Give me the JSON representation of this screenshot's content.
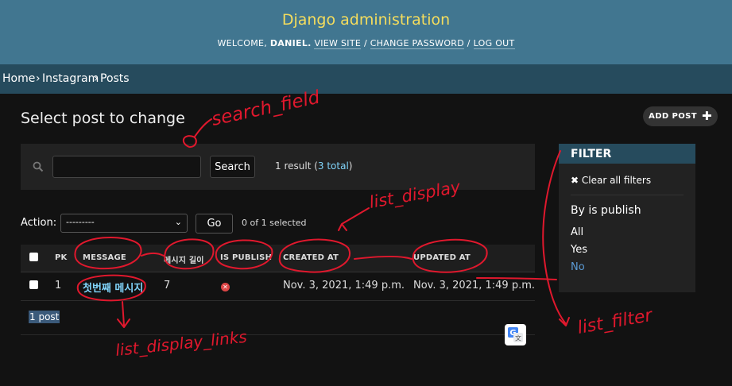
{
  "header": {
    "site_title": "Django administration",
    "welcome_prefix": "WELCOME,",
    "user_name": "DANIEL",
    "view_site": "VIEW SITE",
    "change_password": "CHANGE PASSWORD",
    "log_out": "LOG OUT",
    "separator": "/"
  },
  "breadcrumbs": [
    "Home",
    "Instagram",
    "Posts"
  ],
  "breadcrumb_separator": "›",
  "page": {
    "title": "Select post to change",
    "add_button": "ADD POST",
    "add_icon": "plus-icon"
  },
  "search": {
    "value": "",
    "button": "Search",
    "result_prefix": "1 result (",
    "result_link": "3 total",
    "result_suffix": ")"
  },
  "actions": {
    "label": "Action:",
    "selected": "---------",
    "go_button": "Go",
    "selected_count": "0 of 1 selected"
  },
  "table": {
    "columns": [
      "PK",
      "MESSAGE",
      "메시지 길이",
      "IS PUBLISH",
      "CREATED AT",
      "UPDATED AT"
    ],
    "rows": [
      {
        "pk": "1",
        "message": "첫번째 메시지",
        "length": "7",
        "is_publish": false,
        "created_at": "Nov. 3, 2021, 1:49 p.m.",
        "updated_at": "Nov. 3, 2021, 1:49 p.m."
      }
    ],
    "paginator": "1 post"
  },
  "filter": {
    "title": "FILTER",
    "clear": "✖ Clear all filters",
    "subtitle": "By is publish",
    "options": [
      "All",
      "Yes",
      "No"
    ],
    "selected": "No"
  },
  "annotations": {
    "search_field": "search_field",
    "list_display": "list_display",
    "list_display_links": "list_display_links",
    "list_filter": "list_filter"
  },
  "colors": {
    "header_bg": "#417690",
    "site_title": "#f5dd5d",
    "breadcrumbs_bg": "#264b5d",
    "link": "#81d4fa",
    "annotation": "#e0182d"
  }
}
